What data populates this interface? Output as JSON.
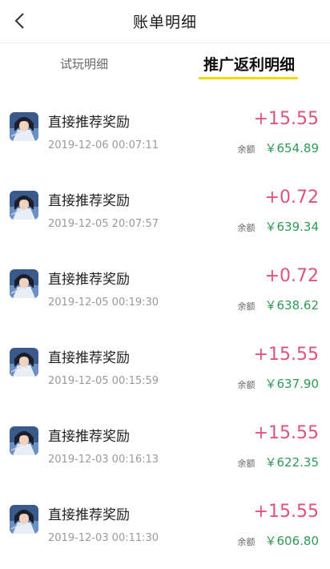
{
  "header": {
    "title": "账单明细",
    "back_icon": "chevron-left-icon"
  },
  "tabs": [
    {
      "label": "试玩明细",
      "active": false
    },
    {
      "label": "推广返利明细",
      "active": true
    }
  ],
  "colors": {
    "accent_underline": "#f5d800",
    "amount": "#e0527a",
    "balance": "#2e9a55"
  },
  "records": [
    {
      "title": "直接推荐奖励",
      "time": "2019-12-06 00:07:11",
      "amount": "+15.55",
      "balance_label": "余额",
      "balance": "￥654.89"
    },
    {
      "title": "直接推荐奖励",
      "time": "2019-12-05 20:07:57",
      "amount": "+0.72",
      "balance_label": "余额",
      "balance": "￥639.34"
    },
    {
      "title": "直接推荐奖励",
      "time": "2019-12-05 00:19:30",
      "amount": "+0.72",
      "balance_label": "余额",
      "balance": "￥638.62"
    },
    {
      "title": "直接推荐奖励",
      "time": "2019-12-05 00:15:59",
      "amount": "+15.55",
      "balance_label": "余额",
      "balance": "￥637.90"
    },
    {
      "title": "直接推荐奖励",
      "time": "2019-12-03 00:16:13",
      "amount": "+15.55",
      "balance_label": "余额",
      "balance": "￥622.35"
    },
    {
      "title": "直接推荐奖励",
      "time": "2019-12-03 00:11:30",
      "amount": "+15.55",
      "balance_label": "余额",
      "balance": "￥606.80"
    }
  ]
}
